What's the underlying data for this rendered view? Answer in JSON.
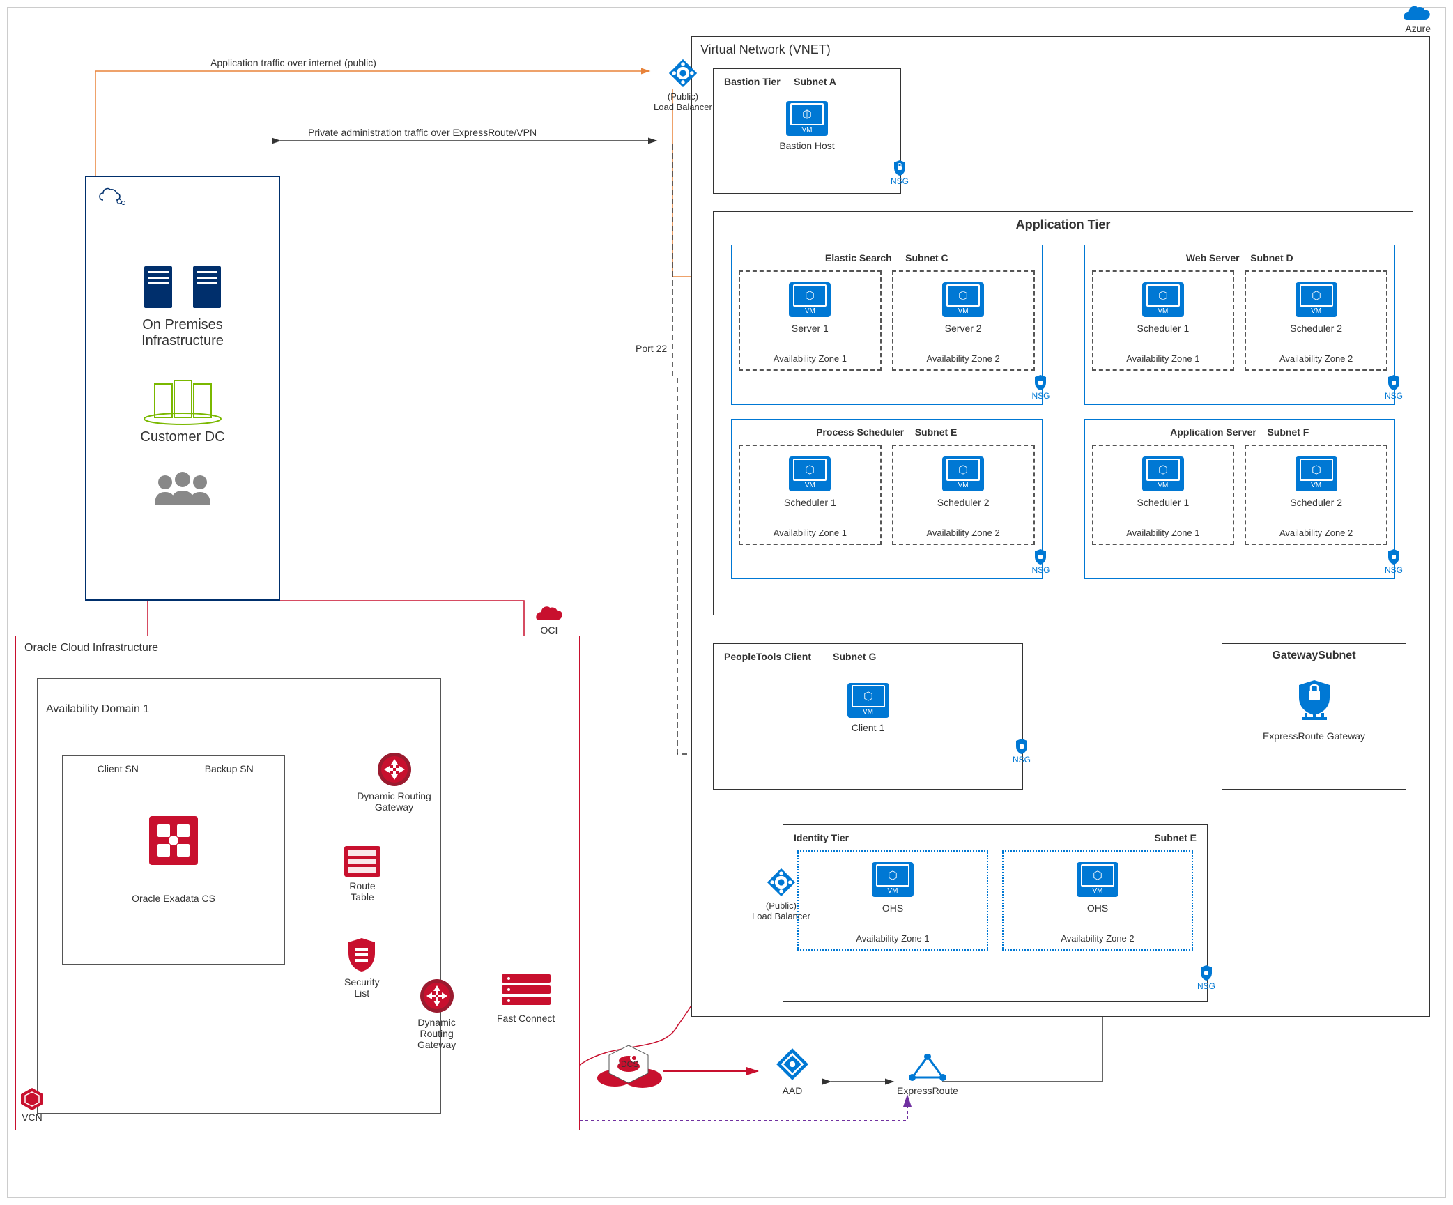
{
  "cloud_labels": {
    "azure": "Azure",
    "oci": "OCI"
  },
  "traffic": {
    "public": "Application traffic over internet (public)",
    "private": "Private administration traffic over ExpressRoute/VPN",
    "port22": "Port 22",
    "port22b": "Port 22"
  },
  "onprem": {
    "infra_line1": "On Premises",
    "infra_line2": "Infrastructure",
    "dc": "Customer DC"
  },
  "oci_region": {
    "title": "Oracle Cloud Infrastructure",
    "vcn": "VCN",
    "ad1": "Availability Domain 1",
    "client_sn": "Client SN",
    "backup_sn": "Backup SN",
    "exadata": "Oracle Exadata CS",
    "drg1": "Dynamic Routing Gateway",
    "drg2": "Dynamic Routing Gateway",
    "route_table": "Route\nTable",
    "security_list": "Security\nList",
    "fast_connect": "Fast Connect",
    "idcs": "IDCS"
  },
  "azure_region": {
    "vnet_title": "Virtual Network (VNET)",
    "lb_public": "(Public)\nLoad Balancer",
    "bastion": {
      "tier": "Bastion Tier",
      "subnet": "Subnet A",
      "host": "Bastion Host"
    },
    "app_tier": {
      "title": "Application Tier",
      "subnets": [
        {
          "group": "Elastic Search",
          "subnet": "Subnet C",
          "vm1": "Server 1",
          "vm2": "Server 2",
          "az1": "Availability Zone 1",
          "az2": "Availability Zone 2"
        },
        {
          "group": "Web Server",
          "subnet": "Subnet D",
          "vm1": "Scheduler 1",
          "vm2": "Scheduler 2",
          "az1": "Availability Zone 1",
          "az2": "Availability Zone 2"
        },
        {
          "group": "Process Scheduler",
          "subnet": "Subnet E",
          "vm1": "Scheduler 1",
          "vm2": "Scheduler 2",
          "az1": "Availability Zone 1",
          "az2": "Availability Zone 2"
        },
        {
          "group": "Application Server",
          "subnet": "Subnet F",
          "vm1": "Scheduler 1",
          "vm2": "Scheduler 2",
          "az1": "Availability Zone 1",
          "az2": "Availability Zone 2"
        }
      ]
    },
    "peopletools": {
      "title": "PeopleTools Client",
      "subnet": "Subnet G",
      "client": "Client 1"
    },
    "gateway_subnet": {
      "title": "GatewaySubnet",
      "gw": "ExpressRoute Gateway"
    },
    "identity": {
      "title": "Identity Tier",
      "subnet": "Subnet E",
      "ohs1": "OHS",
      "ohs2": "OHS",
      "az1": "Availability Zone 1",
      "az2": "Availability Zone 2",
      "lb": "(Public)\nLoad Balancer"
    },
    "aad": "AAD",
    "expressroute": "ExpressRoute",
    "nsg": "NSG"
  }
}
